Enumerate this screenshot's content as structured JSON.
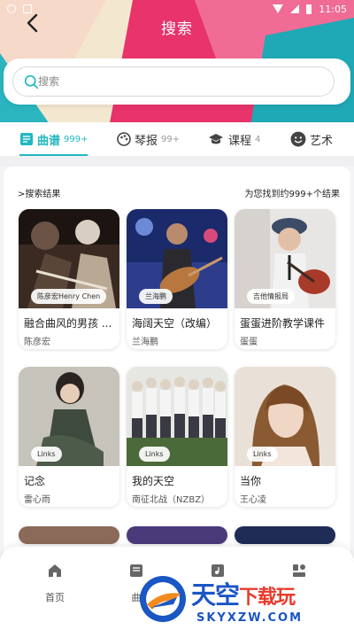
{
  "status_bar": {
    "time": "11:05"
  },
  "header": {
    "title": "搜索",
    "back_icon": "back-arrow-icon"
  },
  "search": {
    "placeholder": "搜索"
  },
  "tabs": [
    {
      "label": "曲谱",
      "count": "999+",
      "icon": "score-icon",
      "active": true
    },
    {
      "label": "琴报",
      "count": "99+",
      "icon": "palette-icon",
      "active": false
    },
    {
      "label": "课程",
      "count": "4",
      "icon": "graduation-cap-icon",
      "active": false
    },
    {
      "label": "艺术",
      "count": "",
      "icon": "smile-icon",
      "active": false
    }
  ],
  "results": {
    "header_left": ">搜索结果",
    "header_right": "为您找到约999+个结果",
    "items": [
      {
        "title": "融合曲风的男孩 ...",
        "artist": "陈彦宏",
        "tag": "陈彦宏Henry Chen"
      },
      {
        "title": "海阔天空（改编）",
        "artist": "兰海鹏",
        "tag": "兰海鹏"
      },
      {
        "title": "蛋蛋进阶教学课件",
        "artist": "蛋蛋",
        "tag": "吉他情报局"
      },
      {
        "title": "记念",
        "artist": "雷心雨",
        "tag": "Links"
      },
      {
        "title": "我的天空",
        "artist": "南征北战（NZBZ）",
        "tag": "Links"
      },
      {
        "title": "当你",
        "artist": "王心凌",
        "tag": "Links"
      }
    ]
  },
  "bottom_nav": [
    {
      "label": "首页",
      "icon": "home-icon"
    },
    {
      "label": "曲",
      "icon": "score-icon"
    },
    {
      "label": "",
      "icon": "music-book-icon"
    },
    {
      "label": "",
      "icon": "profile-icon"
    }
  ],
  "watermark": {
    "main": "天空",
    "red": "下载玩",
    "sub": "SKYXZW.COM"
  },
  "colors": {
    "accent": "#23b8c0",
    "hero_pink": "#e8336b",
    "watermark_blue": "#1a56c4"
  }
}
